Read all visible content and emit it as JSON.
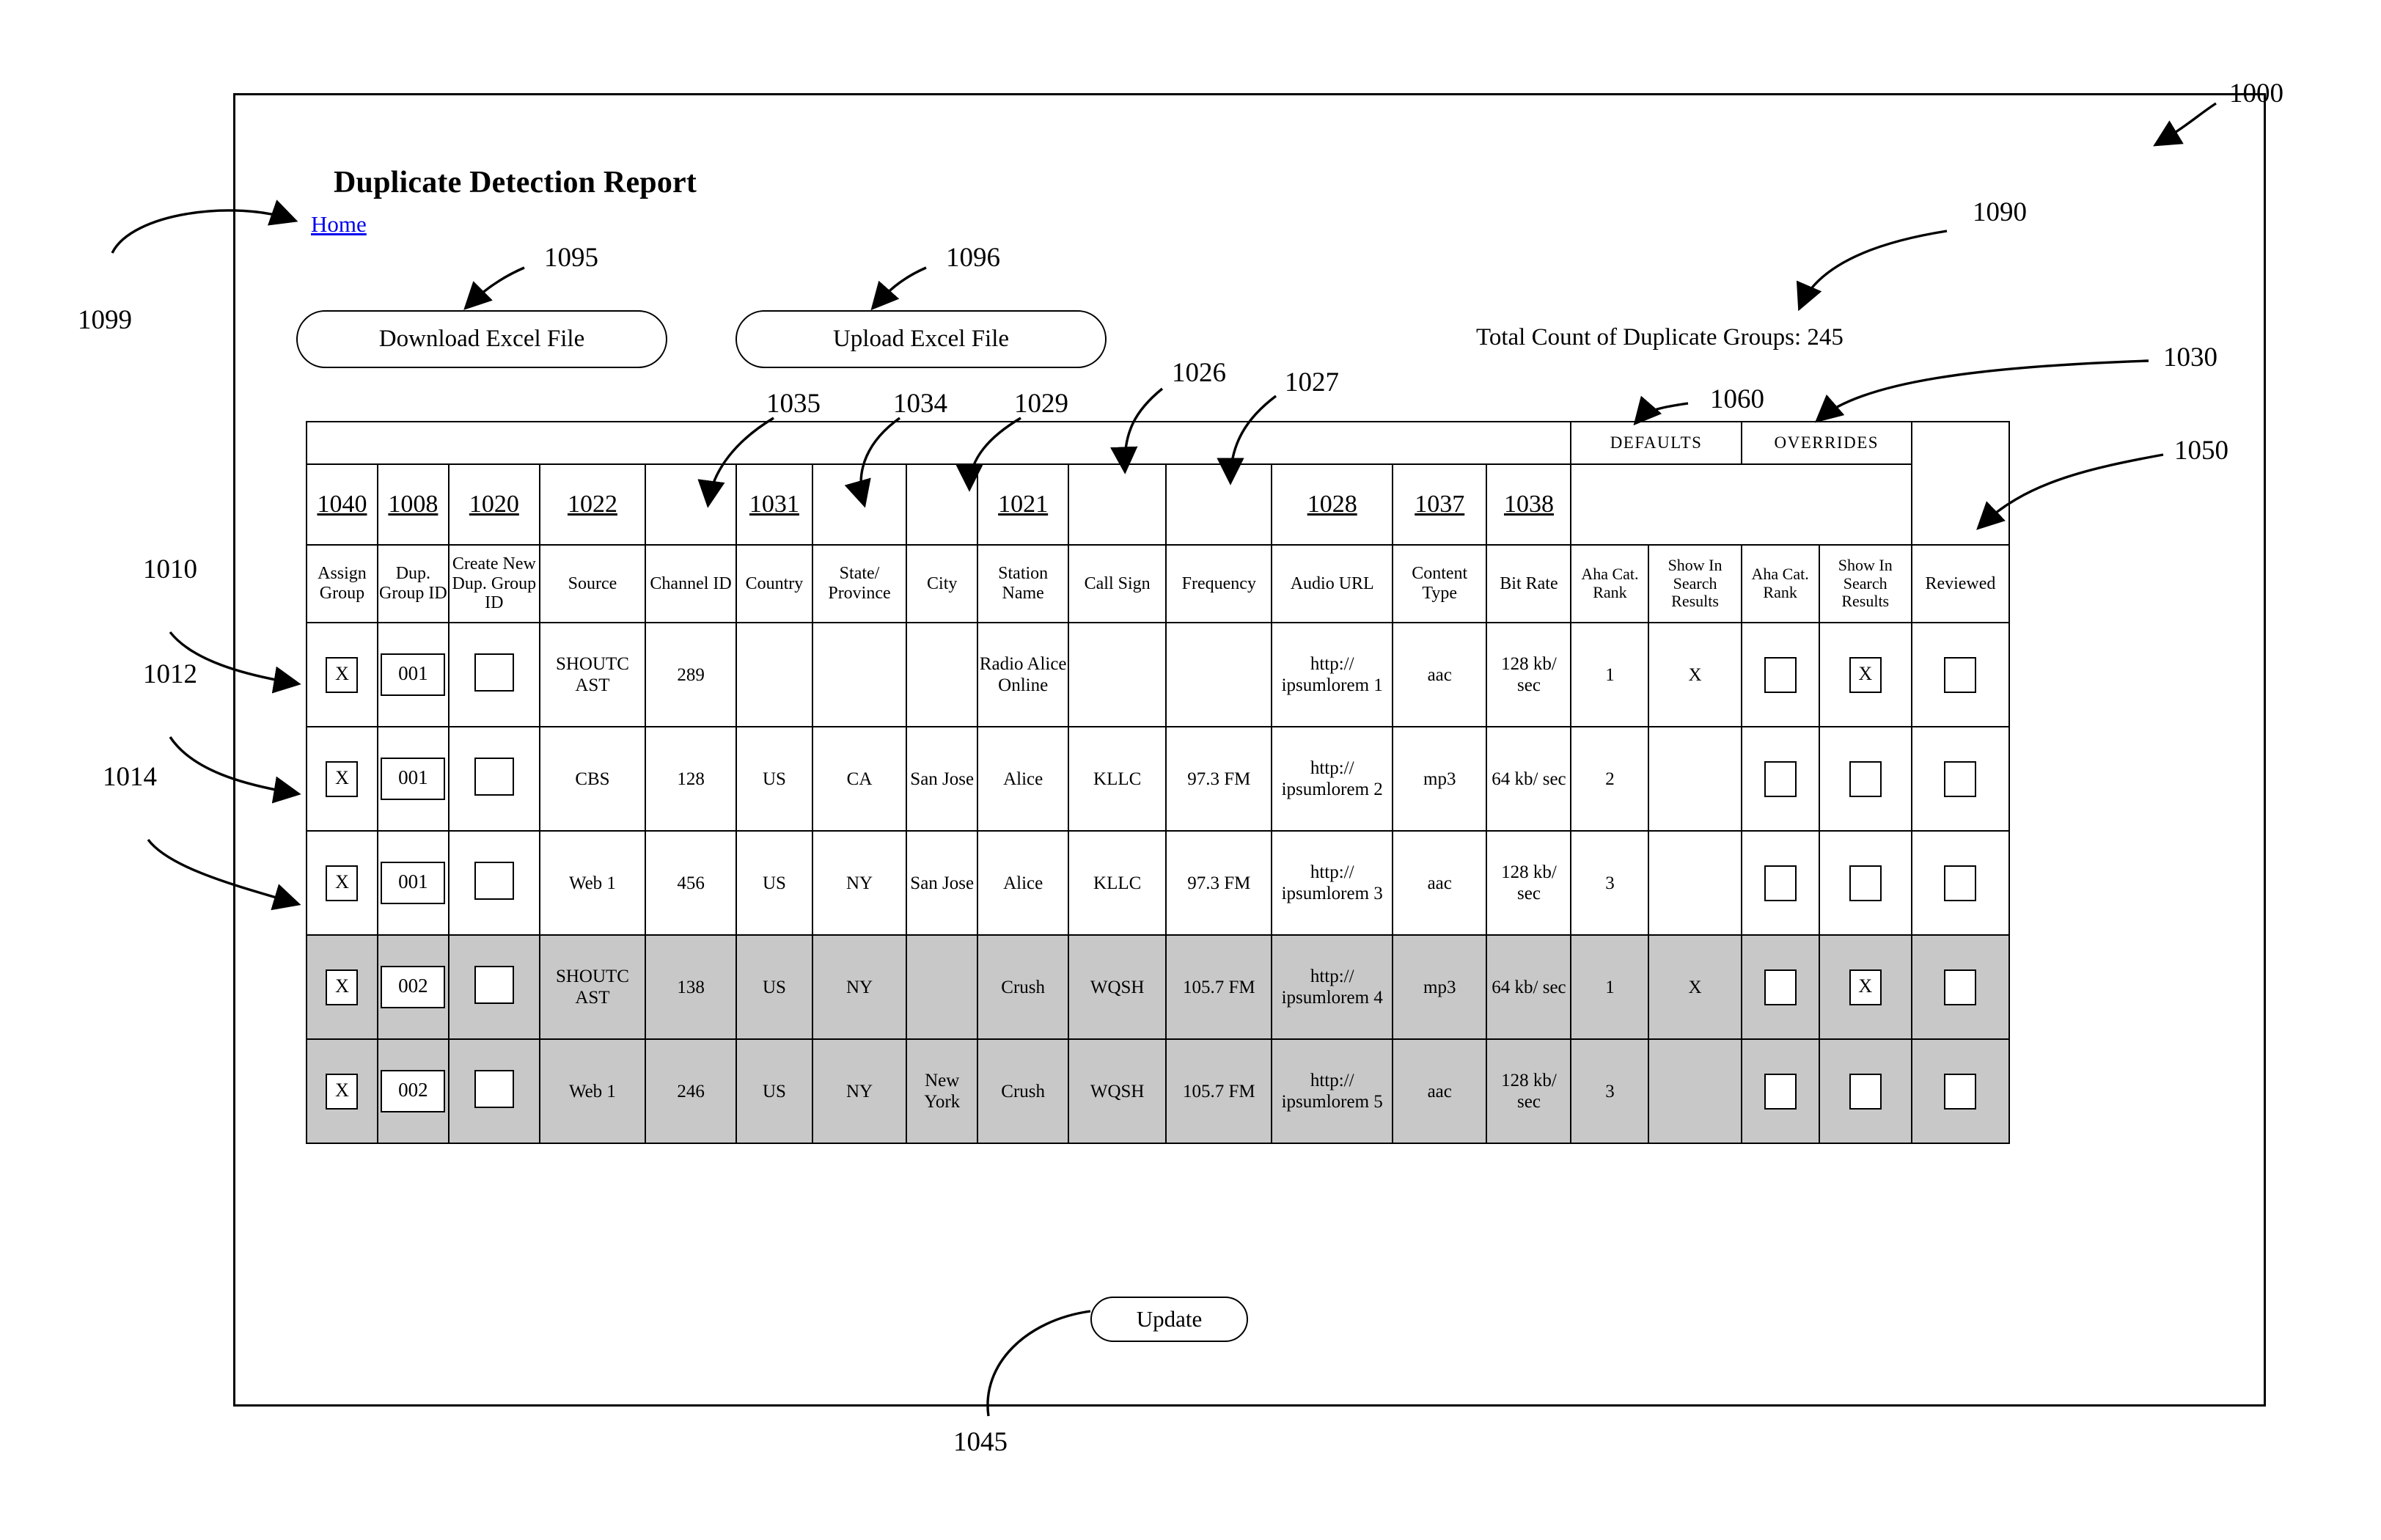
{
  "figure": {
    "number": "1000",
    "title": "Duplicate Detection Report"
  },
  "header": {
    "title": "Duplicate Detection Report",
    "home_link": "Home",
    "total_count": "Total Count of Duplicate Groups: 245"
  },
  "toolbar": {
    "download_label": "Download Excel File",
    "upload_label": "Upload Excel File",
    "update_label": "Update"
  },
  "table": {
    "group_bands": [
      {
        "label": "DEFAULTS",
        "span": 2
      },
      {
        "label": "OVERRIDES",
        "span": 2
      }
    ],
    "ref_row": [
      "1040",
      "1008",
      "1020",
      "1022",
      "",
      "1031",
      "",
      "",
      "1021",
      "",
      "",
      "1028",
      "1037",
      "1038"
    ],
    "columns": [
      "Assign Group",
      "Dup. Group ID",
      "Create New Dup. Group ID",
      "Source",
      "Channel ID",
      "Country",
      "State/ Province",
      "City",
      "Station Name",
      "Call Sign",
      "Frequency",
      "Audio URL",
      "Content Type",
      "Bit Rate",
      "Aha Cat. Rank",
      "Show In Search Results",
      "Aha Cat. Rank",
      "Show In Search Results",
      "Reviewed"
    ],
    "rows": [
      {
        "shaded": false,
        "assign_group": "X",
        "dup_group_id": "001",
        "create_new_dup_group_id": "",
        "source": "SHOUTC AST",
        "channel_id": "289",
        "country": "",
        "state_province": "",
        "city": "",
        "station_name": "Radio Alice Online",
        "call_sign": "",
        "frequency": "",
        "audio_url": "http:// ipsumlorem 1",
        "content_type": "aac",
        "bit_rate": "128 kb/ sec",
        "default_aha_cat_rank": "1",
        "default_show_in_search": "X",
        "override_aha_cat_rank": "",
        "override_show_in_search": "X",
        "reviewed": ""
      },
      {
        "shaded": false,
        "assign_group": "X",
        "dup_group_id": "001",
        "create_new_dup_group_id": "",
        "source": "CBS",
        "channel_id": "128",
        "country": "US",
        "state_province": "CA",
        "city": "San Jose",
        "station_name": "Alice",
        "call_sign": "KLLC",
        "frequency": "97.3 FM",
        "audio_url": "http:// ipsumlorem 2",
        "content_type": "mp3",
        "bit_rate": "64 kb/ sec",
        "default_aha_cat_rank": "2",
        "default_show_in_search": "",
        "override_aha_cat_rank": "",
        "override_show_in_search": "",
        "reviewed": ""
      },
      {
        "shaded": false,
        "assign_group": "X",
        "dup_group_id": "001",
        "create_new_dup_group_id": "",
        "source": "Web 1",
        "channel_id": "456",
        "country": "US",
        "state_province": "NY",
        "city": "San Jose",
        "station_name": "Alice",
        "call_sign": "KLLC",
        "frequency": "97.3 FM",
        "audio_url": "http:// ipsumlorem 3",
        "content_type": "aac",
        "bit_rate": "128 kb/ sec",
        "default_aha_cat_rank": "3",
        "default_show_in_search": "",
        "override_aha_cat_rank": "",
        "override_show_in_search": "",
        "reviewed": ""
      },
      {
        "shaded": true,
        "assign_group": "X",
        "dup_group_id": "002",
        "create_new_dup_group_id": "",
        "source": "SHOUTC AST",
        "channel_id": "138",
        "country": "US",
        "state_province": "NY",
        "city": "",
        "station_name": "Crush",
        "call_sign": "WQSH",
        "frequency": "105.7 FM",
        "audio_url": "http:// ipsumlorem 4",
        "content_type": "mp3",
        "bit_rate": "64 kb/ sec",
        "default_aha_cat_rank": "1",
        "default_show_in_search": "X",
        "override_aha_cat_rank": "",
        "override_show_in_search": "X",
        "reviewed": ""
      },
      {
        "shaded": true,
        "assign_group": "X",
        "dup_group_id": "002",
        "create_new_dup_group_id": "",
        "source": "Web 1",
        "channel_id": "246",
        "country": "US",
        "state_province": "NY",
        "city": "New York",
        "station_name": "Crush",
        "call_sign": "WQSH",
        "frequency": "105.7 FM",
        "audio_url": "http:// ipsumlorem 5",
        "content_type": "aac",
        "bit_rate": "128 kb/ sec",
        "default_aha_cat_rank": "3",
        "default_show_in_search": "",
        "override_aha_cat_rank": "",
        "override_show_in_search": "",
        "reviewed": ""
      }
    ]
  },
  "reference_numerals": {
    "n1000": "1000",
    "n1010": "1010",
    "n1012": "1012",
    "n1014": "1014",
    "n1026": "1026",
    "n1027": "1027",
    "n1029": "1029",
    "n1030": "1030",
    "n1034": "1034",
    "n1035": "1035",
    "n1045": "1045",
    "n1050": "1050",
    "n1060": "1060",
    "n1090": "1090",
    "n1095": "1095",
    "n1096": "1096",
    "n1099": "1099"
  }
}
